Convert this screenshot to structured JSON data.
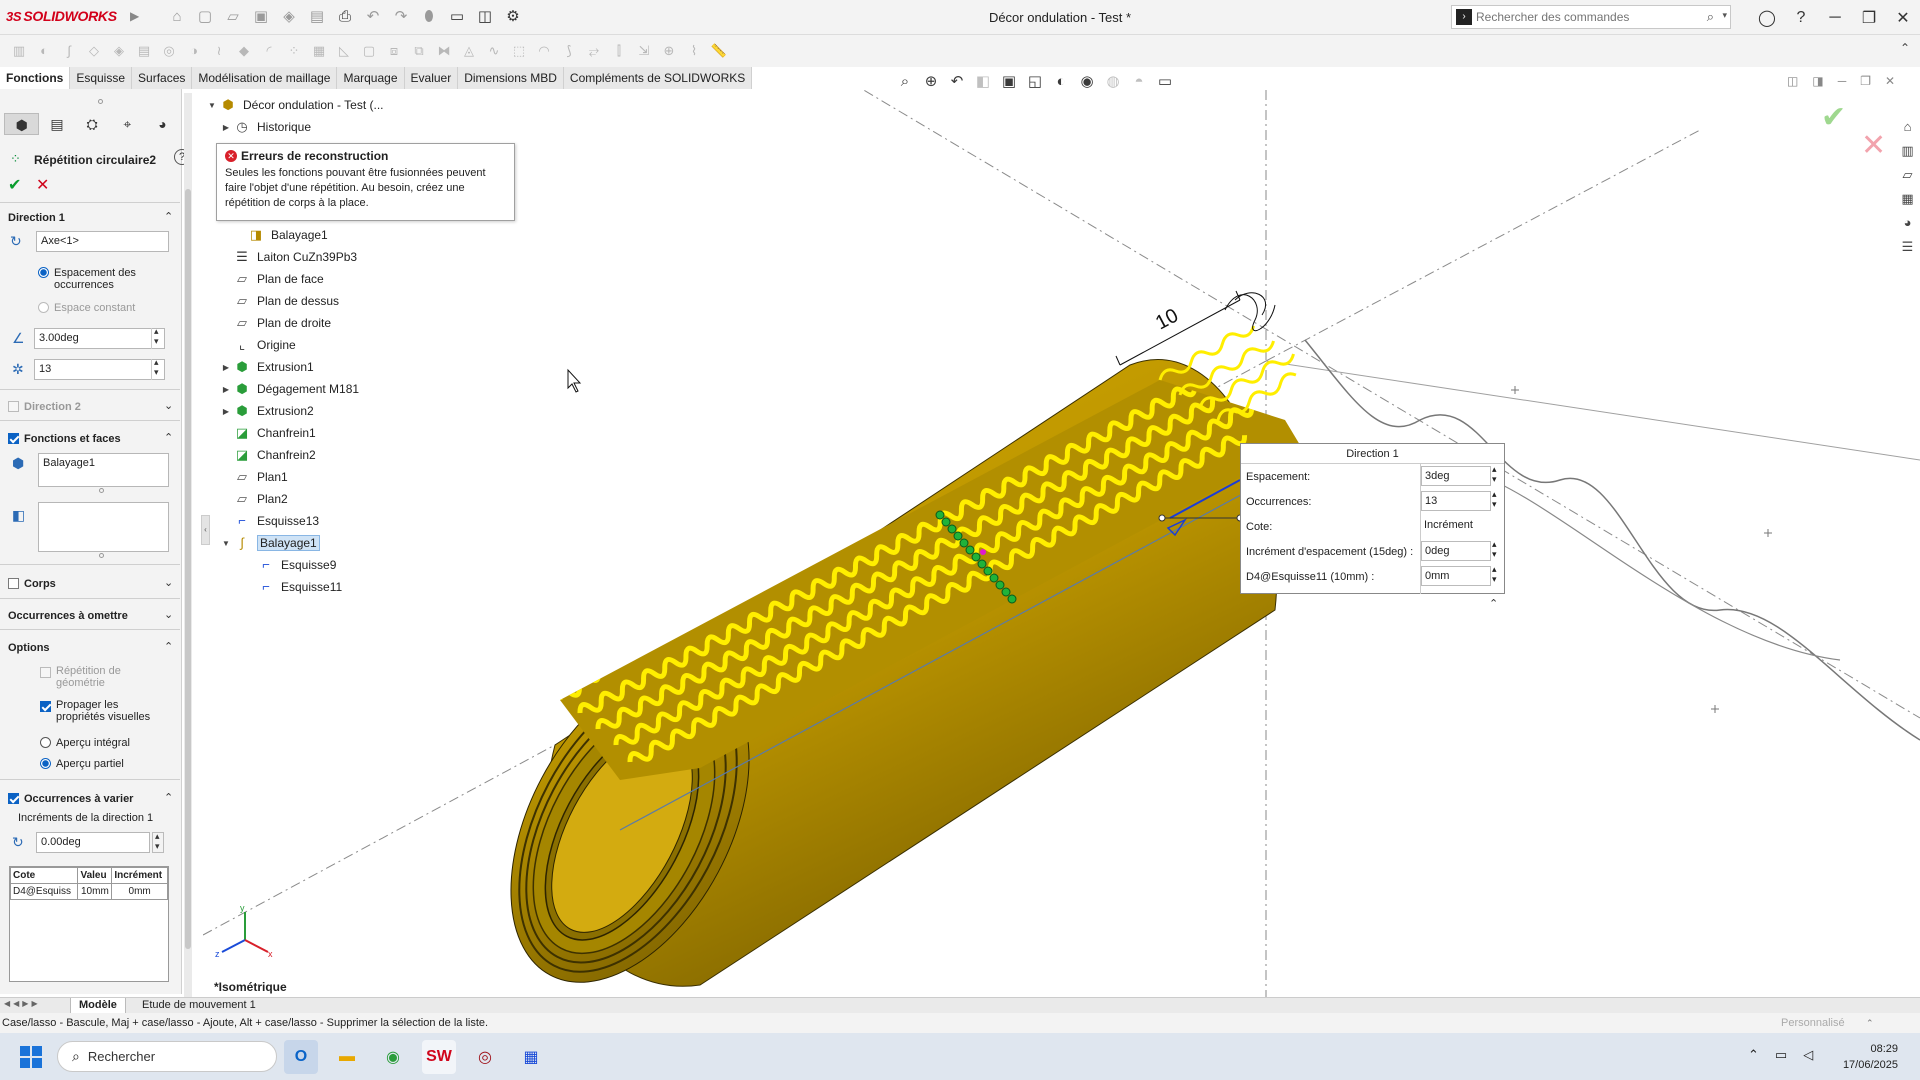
{
  "app": {
    "brand": "SOLIDWORKS",
    "window_title": "Décor ondulation - Test *"
  },
  "search": {
    "placeholder": "Rechercher des commandes"
  },
  "tabs": [
    {
      "label": "Fonctions"
    },
    {
      "label": "Esquisse"
    },
    {
      "label": "Surfaces"
    },
    {
      "label": "Modélisation de maillage"
    },
    {
      "label": "Marquage"
    },
    {
      "label": "Evaluer"
    },
    {
      "label": "Dimensions MBD"
    },
    {
      "label": "Compléments de SOLIDWORKS"
    }
  ],
  "pm": {
    "title": "Répétition circulaire2",
    "direction1": {
      "header": "Direction 1",
      "axis": "Axe<1>",
      "opt_spacing": "Espacement des occurrences",
      "opt_constant": "Espace constant",
      "angle": "3.00deg",
      "count": "13"
    },
    "direction2": {
      "header": "Direction 2"
    },
    "features_faces": {
      "header": "Fonctions et faces",
      "feature": "Balayage1"
    },
    "bodies": {
      "header": "Corps"
    },
    "skip": {
      "header": "Occurrences à omettre"
    },
    "options": {
      "header": "Options",
      "geom_pattern": "Répétition de géométrie",
      "propagate": "Propager les propriétés visuelles",
      "full_preview": "Aperçu intégral",
      "partial_preview": "Aperçu partiel"
    },
    "vary": {
      "header": "Occurrences à varier",
      "sub": "Incréments de la direction 1",
      "increment": "0.00deg",
      "table_headers": [
        "Cote",
        "Valeu",
        "Incrément"
      ],
      "table_rows": [
        [
          "D4@Esquiss",
          "10mm",
          "0mm"
        ]
      ]
    }
  },
  "tree": {
    "root": "Décor ondulation - Test (...",
    "items": [
      {
        "label": "Historique"
      },
      {
        "label": "Balayage1"
      },
      {
        "label": "Laiton CuZn39Pb3"
      },
      {
        "label": "Plan de face"
      },
      {
        "label": "Plan de dessus"
      },
      {
        "label": "Plan de droite"
      },
      {
        "label": "Origine"
      },
      {
        "label": "Extrusion1"
      },
      {
        "label": "Dégagement M181"
      },
      {
        "label": "Extrusion2"
      },
      {
        "label": "Chanfrein1"
      },
      {
        "label": "Chanfrein2"
      },
      {
        "label": "Plan1"
      },
      {
        "label": "Plan2"
      },
      {
        "label": "Esquisse13"
      },
      {
        "label": "Balayage1"
      },
      {
        "label": "Esquisse9"
      },
      {
        "label": "Esquisse11"
      }
    ]
  },
  "error_tip": {
    "title": "Erreurs de reconstruction",
    "body": "Seules les fonctions pouvant être fusionnées peuvent faire l'objet d'une répétition. Au besoin, créez une répétition de corps à la place."
  },
  "callout": {
    "title": "Direction 1",
    "rows": [
      {
        "label": "Espacement:",
        "value": "3deg"
      },
      {
        "label": "Occurrences:",
        "value": "13"
      },
      {
        "label": "Cote:",
        "value": "Incrément"
      },
      {
        "label": "Incrément d'espacement (15deg) :",
        "value": "0deg"
      },
      {
        "label": "D4@Esquisse11 (10mm) :",
        "value": "0mm"
      }
    ]
  },
  "viewport": {
    "view_name": "*Isométrique",
    "dimension_label": "10",
    "part_color": "#c9a000",
    "wave_color": "#ffee00"
  },
  "bottom_tabs": [
    "Modèle",
    "Etude de mouvement 1"
  ],
  "status": {
    "hint": "Case/lasso - Bascule, Maj + case/lasso - Ajoute, Alt + case/lasso - Supprimer la sélection de la liste.",
    "mode": "Personnalisé"
  },
  "taskbar": {
    "search_label": "Rechercher",
    "time": "08:29",
    "date": "17/06/2025"
  }
}
